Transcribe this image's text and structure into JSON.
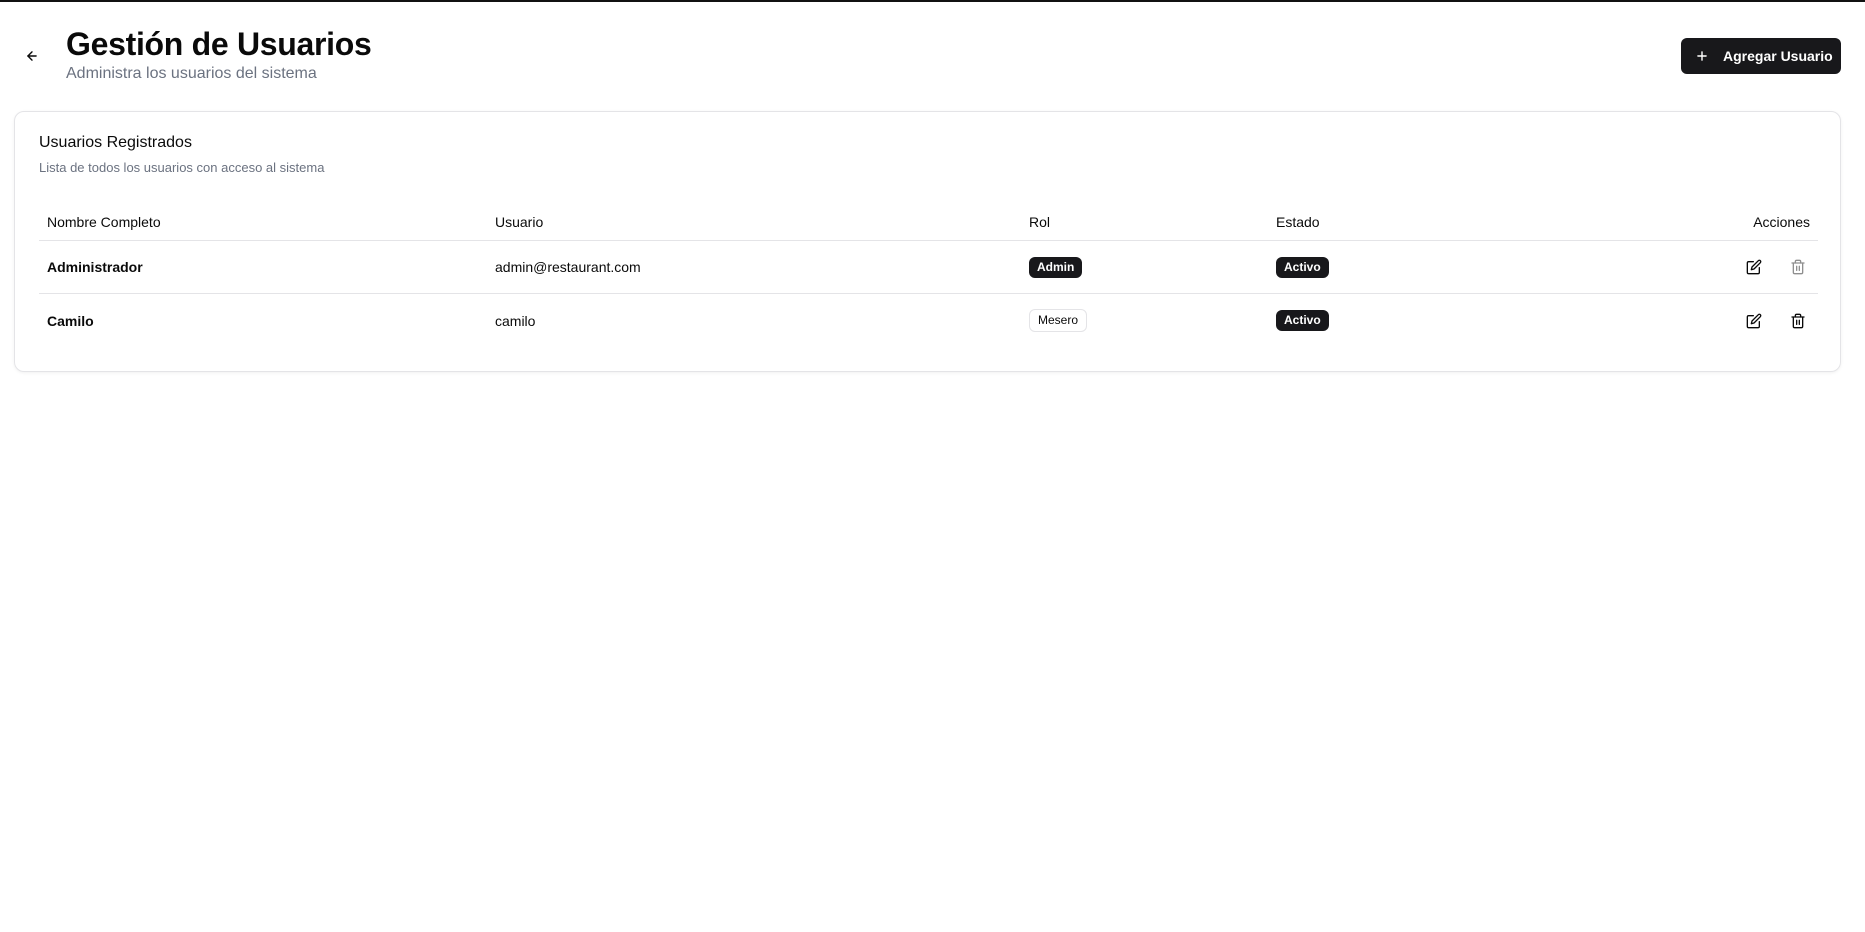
{
  "header": {
    "title": "Gestión de Usuarios",
    "subtitle": "Administra los usuarios del sistema",
    "add_button_label": "Agregar Usuario"
  },
  "card": {
    "title": "Usuarios Registrados",
    "description": "Lista de todos los usuarios con acceso al sistema"
  },
  "table": {
    "columns": [
      "Nombre Completo",
      "Usuario",
      "Rol",
      "Estado",
      "Acciones"
    ],
    "rows": [
      {
        "name": "Administrador",
        "username": "admin@restaurant.com",
        "role": "Admin",
        "status": "Activo",
        "delete_disabled": true
      },
      {
        "name": "Camilo",
        "username": "camilo",
        "role": "Mesero",
        "status": "Activo",
        "delete_disabled": false
      }
    ]
  },
  "icons": {
    "back": "arrow-left-icon",
    "add": "plus-icon",
    "edit": "edit-icon",
    "delete": "trash-icon"
  },
  "colors": {
    "primary": "#18181b",
    "muted_text": "#6b7280",
    "border": "#e4e4e7"
  }
}
